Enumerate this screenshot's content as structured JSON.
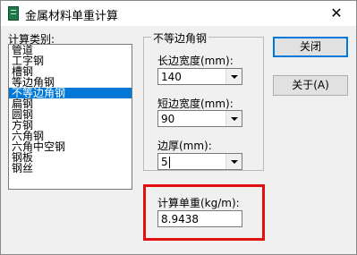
{
  "window": {
    "title": "金属材料单重计算",
    "close_glyph": "✕"
  },
  "category": {
    "label": "计算类别:",
    "items": [
      "管道",
      "工字钢",
      "槽钢",
      "等边角钢",
      "不等边角钢",
      "扁钢",
      "圆钢",
      "方钢",
      "六角钢",
      "六角中空钢",
      "钢板",
      "钢丝"
    ],
    "selected_index": 4
  },
  "group": {
    "title": "不等边角钢"
  },
  "long_edge": {
    "label": "长边宽度(mm):",
    "value": "140"
  },
  "short_edge": {
    "label": "短边宽度(mm):",
    "value": "90"
  },
  "thickness": {
    "label": "边厚(mm):",
    "value": "5"
  },
  "result": {
    "label": "计算单重(kg/m):",
    "value": "8.9438"
  },
  "buttons": {
    "close": "关闭",
    "about": "关于(A)"
  },
  "colors": {
    "highlight": "#e01010",
    "selection": "#0078d7"
  }
}
